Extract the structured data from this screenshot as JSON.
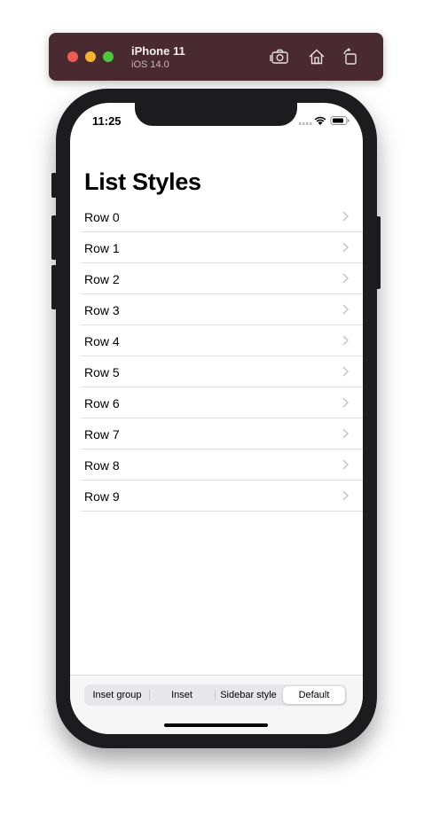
{
  "simulator": {
    "device_name": "iPhone 11",
    "os_version": "iOS 14.0",
    "icons": [
      "screenshot-icon",
      "home-icon",
      "rotate-icon"
    ]
  },
  "status_bar": {
    "time": "11:25",
    "icons": [
      "cellular-icon",
      "wifi-icon",
      "battery-icon"
    ]
  },
  "page": {
    "title": "List Styles"
  },
  "rows": [
    {
      "label": "Row 0"
    },
    {
      "label": "Row 1"
    },
    {
      "label": "Row 2"
    },
    {
      "label": "Row 3"
    },
    {
      "label": "Row 4"
    },
    {
      "label": "Row 5"
    },
    {
      "label": "Row 6"
    },
    {
      "label": "Row 7"
    },
    {
      "label": "Row 8"
    },
    {
      "label": "Row 9"
    }
  ],
  "segmented_control": {
    "options": [
      "Inset group",
      "Inset",
      "Sidebar style",
      "Default"
    ],
    "selected": "Default"
  },
  "colors": {
    "title_bar": "#4a2a31",
    "phone_frame": "#1c1c1e",
    "separator": "#e1e1e3",
    "chevron": "#c4c4c7"
  }
}
